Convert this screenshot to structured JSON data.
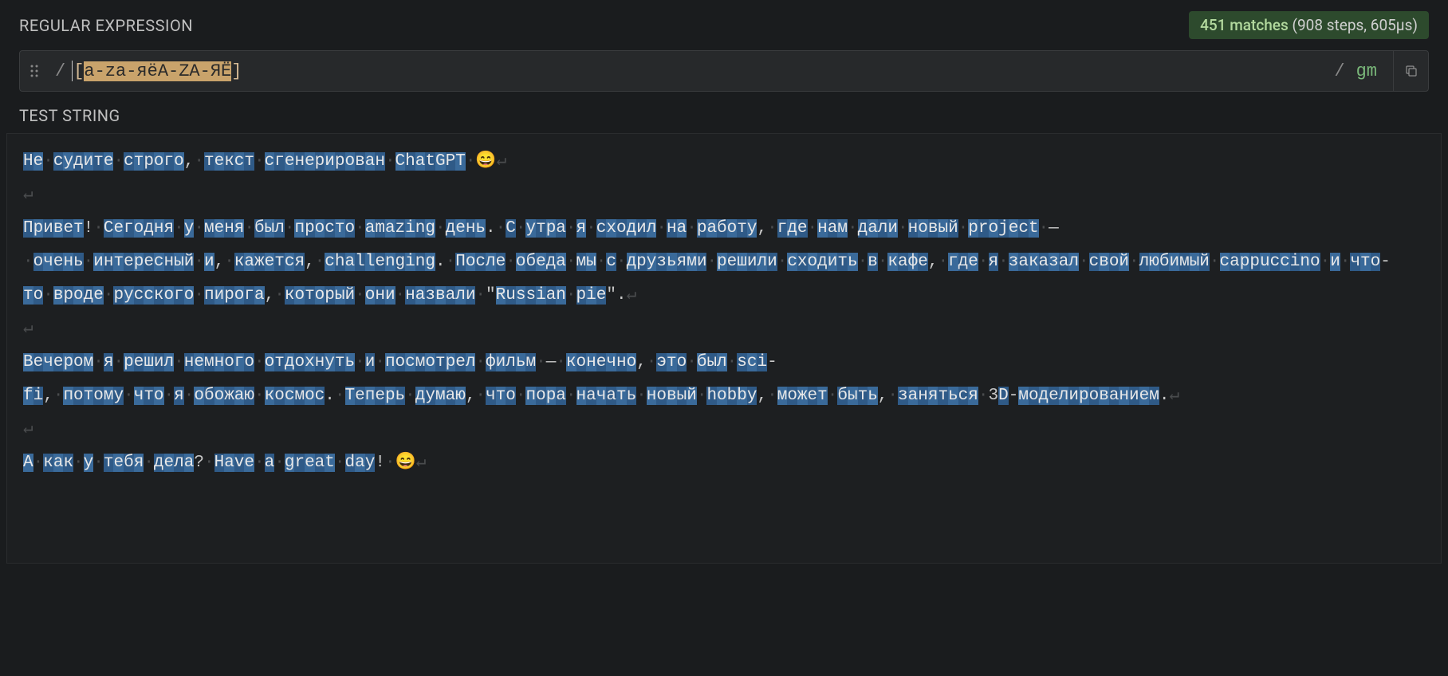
{
  "labels": {
    "regex_section": "REGULAR EXPRESSION",
    "test_section": "TEST STRING"
  },
  "match_info": {
    "count_text": "451 matches",
    "detail_text": "(908 steps, 605µs)"
  },
  "regex": {
    "open_delim": "/",
    "pattern_open": "[",
    "pattern_body": "a-za-яёA-ZA-ЯЁ",
    "pattern_close": "]",
    "close_delim": "/",
    "flags": "gm"
  },
  "test_string": "Не судите строго, текст сгенерирован ChatGPT 😄\n\nПривет! Сегодня у меня был просто amazing день. С утра я сходил на работу, где нам дали новый project — очень интересный и, кажется, challenging. После обеда мы с друзьями решили сходить в кафе, где я заказал свой любимый cappuccino и что-то вроде русского пирога, который они назвали \"Russian pie\".\n\nВечером я решил немного отдохнуть и посмотрел фильм — конечно, это был sci-fi, потому что я обожаю космос. Теперь думаю, что пора начать новый hobby, может быть, заняться 3D-моделированием.\n\nА как у тебя дела? Have a great day! 😄",
  "icons": {
    "copy": "copy-icon",
    "drag": "drag-handle-icon"
  }
}
